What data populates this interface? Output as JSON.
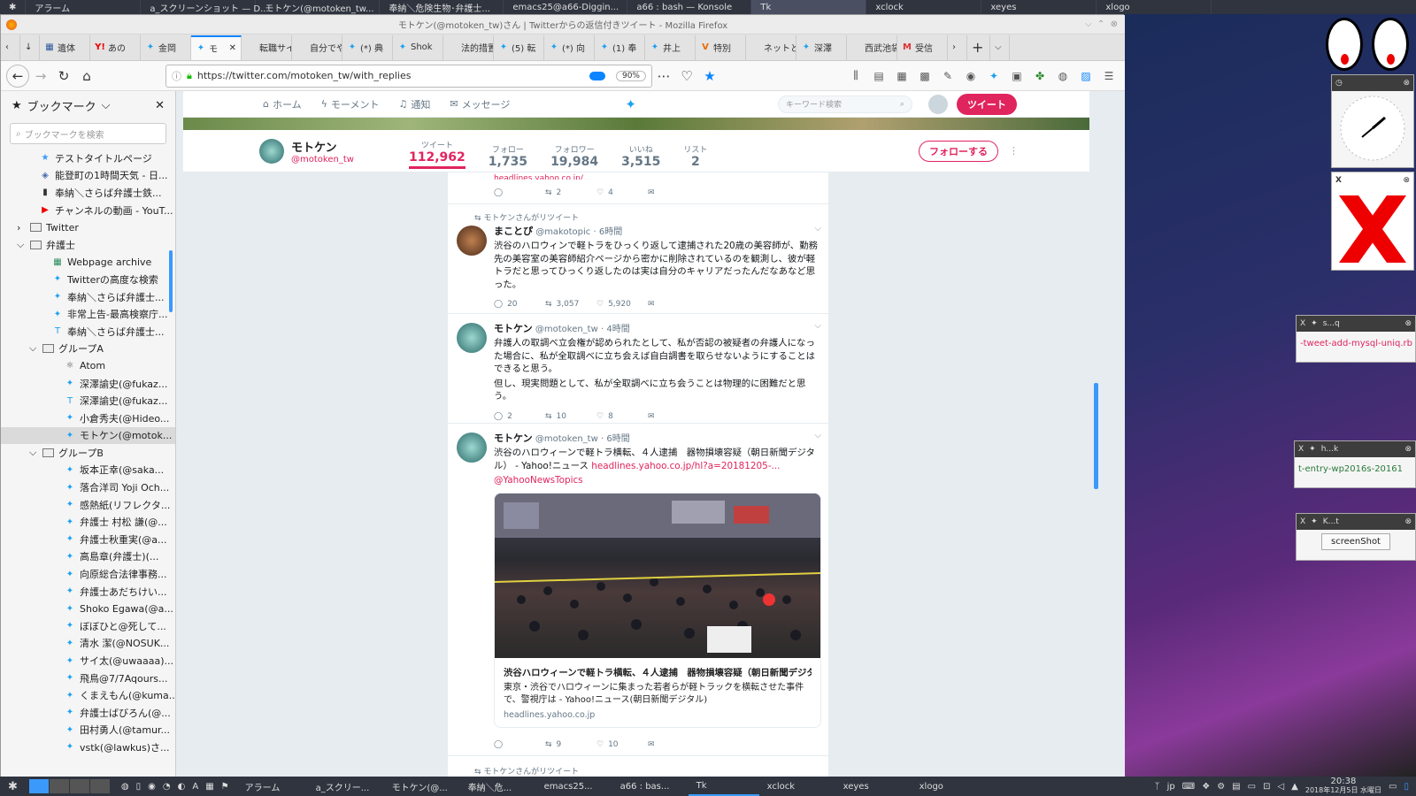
{
  "topbar": {
    "items": [
      "アラーム",
      "a_スクリーンショット — D...",
      "モトケン(@motoken_tw...",
      "奉納＼危険生物･弁護士...",
      "emacs25@a66-Diggin...",
      "a66 : bash — Konsole",
      "Tk",
      "xclock",
      "xeyes",
      "xlogo"
    ]
  },
  "window": {
    "title": "モトケン(@motoken_tw)さん | Twitterからの返信付きツイート - Mozilla Firefox"
  },
  "tabs": [
    {
      "label": "遺体",
      "icon": "jp"
    },
    {
      "label": "あの",
      "icon": "y"
    },
    {
      "label": "金岡",
      "icon": "tw"
    },
    {
      "label": "モ",
      "icon": "tw",
      "selected": true
    },
    {
      "label": "転職サイ",
      "icon": ""
    },
    {
      "label": "自分でや",
      "icon": ""
    },
    {
      "label": "(*) 典",
      "icon": "tw"
    },
    {
      "label": "Shok",
      "icon": "tw"
    },
    {
      "label": "法的措置",
      "icon": ""
    },
    {
      "label": "(5) 転",
      "icon": "tw"
    },
    {
      "label": "(*) 向",
      "icon": "tw"
    },
    {
      "label": "(1) 奉",
      "icon": "tw"
    },
    {
      "label": "井上",
      "icon": "tw"
    },
    {
      "label": "特別",
      "icon": "v"
    },
    {
      "label": "ネットと著",
      "icon": ""
    },
    {
      "label": "深澤",
      "icon": "tw"
    },
    {
      "label": "西武池袋",
      "icon": ""
    },
    {
      "label": "受信",
      "icon": "m"
    }
  ],
  "url": {
    "value": "https://twitter.com/motoken_tw/with_replies",
    "zoom": "90%"
  },
  "sidebar": {
    "title": "ブックマーク",
    "search_placeholder": "ブックマークを検索",
    "items": [
      {
        "label": "テストタイトルページ",
        "indent": 44,
        "icon": "star",
        "type": "bm"
      },
      {
        "label": "能登町の1時間天気 - 日...",
        "indent": 44,
        "icon": "cube",
        "type": "bm"
      },
      {
        "label": "奉納＼さらば弁護士鉄...",
        "indent": 44,
        "icon": "bar",
        "type": "bm"
      },
      {
        "label": "チャンネルの動画 - YouT...",
        "indent": 44,
        "icon": "yt",
        "type": "bm"
      },
      {
        "label": "Twitter",
        "indent": 32,
        "icon": "folder",
        "type": "folder",
        "collapsed": true
      },
      {
        "label": "弁護士",
        "indent": 32,
        "icon": "folder",
        "type": "folder"
      },
      {
        "label": "Webpage archive",
        "indent": 58,
        "icon": "arc",
        "type": "bm"
      },
      {
        "label": "Twitterの高度な検索",
        "indent": 58,
        "icon": "tw",
        "type": "bm"
      },
      {
        "label": "奉納＼さらば弁護士...",
        "indent": 58,
        "icon": "tw",
        "type": "bm"
      },
      {
        "label": "非常上告-最高検察庁...",
        "indent": 58,
        "icon": "tw",
        "type": "bm"
      },
      {
        "label": "奉納＼さらば弁護士...",
        "indent": 58,
        "icon": "t",
        "type": "bm"
      },
      {
        "label": "グループA",
        "indent": 46,
        "icon": "folder",
        "type": "folder"
      },
      {
        "label": "Atom",
        "indent": 72,
        "icon": "atom",
        "type": "bm"
      },
      {
        "label": "深澤諭史(@fukaz...",
        "indent": 72,
        "icon": "tw",
        "type": "bm"
      },
      {
        "label": "深澤諭史(@fukaz...",
        "indent": 72,
        "icon": "t",
        "type": "bm"
      },
      {
        "label": "小倉秀夫(@Hideo...",
        "indent": 72,
        "icon": "tw",
        "type": "bm"
      },
      {
        "label": "モトケン(@motok...",
        "indent": 72,
        "icon": "tw",
        "type": "bm",
        "selected": true
      },
      {
        "label": "グループB",
        "indent": 46,
        "icon": "folder",
        "type": "folder"
      },
      {
        "label": "坂本正幸(@saka...",
        "indent": 72,
        "icon": "tw",
        "type": "bm"
      },
      {
        "label": "落合洋司 Yoji Och...",
        "indent": 72,
        "icon": "tw",
        "type": "bm"
      },
      {
        "label": "感熱紙(リフレクタ...",
        "indent": 72,
        "icon": "tw",
        "type": "bm"
      },
      {
        "label": "弁護士 村松 謙(@...",
        "indent": 72,
        "icon": "tw",
        "type": "bm"
      },
      {
        "label": "弁護士秋重実(@a...",
        "indent": 72,
        "icon": "tw",
        "type": "bm"
      },
      {
        "label": "高島章(弁護士)(...",
        "indent": 72,
        "icon": "tw",
        "type": "bm"
      },
      {
        "label": "向原総合法律事務...",
        "indent": 72,
        "icon": "tw",
        "type": "bm"
      },
      {
        "label": "弁護士あだちけい...",
        "indent": 72,
        "icon": "tw",
        "type": "bm"
      },
      {
        "label": "Shoko Egawa(@a...",
        "indent": 72,
        "icon": "tw",
        "type": "bm"
      },
      {
        "label": "ぼぼひと@死して...",
        "indent": 72,
        "icon": "tw",
        "type": "bm"
      },
      {
        "label": "清水 潔(@NOSUK...",
        "indent": 72,
        "icon": "tw",
        "type": "bm"
      },
      {
        "label": "サイ太(@uwaaaa)...",
        "indent": 72,
        "icon": "tw",
        "type": "bm"
      },
      {
        "label": "飛鳥@7/7Aqours...",
        "indent": 72,
        "icon": "tw",
        "type": "bm"
      },
      {
        "label": "くまえもん(@kuma...",
        "indent": 72,
        "icon": "tw",
        "type": "bm"
      },
      {
        "label": "弁護士ばびろん(@...",
        "indent": 72,
        "icon": "tw",
        "type": "bm"
      },
      {
        "label": "田村勇人(@tamur...",
        "indent": 72,
        "icon": "tw",
        "type": "bm"
      },
      {
        "label": "vstk(@lawkus)さ...",
        "indent": 72,
        "icon": "tw",
        "type": "bm"
      }
    ]
  },
  "twitter": {
    "nav": {
      "home": "ホーム",
      "moments": "モーメント",
      "notifications": "通知",
      "messages": "メッセージ",
      "search_placeholder": "キーワード検索",
      "tweet_button": "ツイート"
    },
    "profile": {
      "name": "モトケン",
      "handle": "@motoken_tw",
      "stats": [
        {
          "label": "ツイート",
          "value": "112,962",
          "active": true
        },
        {
          "label": "フォロー",
          "value": "1,735"
        },
        {
          "label": "フォロワー",
          "value": "19,984"
        },
        {
          "label": "いいね",
          "value": "3,515"
        },
        {
          "label": "リスト",
          "value": "2"
        }
      ],
      "follow_button": "フォローする"
    },
    "tweets": [
      {
        "partial": true,
        "replies": "",
        "retweets": "2",
        "likes": "4"
      },
      {
        "retweet_note": "モトケンさんがリツイート",
        "name": "まことぴ",
        "handle": "@makotopic",
        "time": "6時間",
        "text": "渋谷のハロウィンで軽トラをひっくり返して逮捕された20歳の美容師が、勤務先の美容室の美容師紹介ページから密かに削除されているのを観測し、彼が軽トラだと思ってひっくり返したのは実は自分のキャリアだったんだなあなど思った。",
        "replies": "20",
        "retweets": "3,057",
        "likes": "5,920"
      },
      {
        "name": "モトケン",
        "handle": "@motoken_tw",
        "time": "4時間",
        "text": "弁護人の取調べ立会権が認められたとして、私が否認の被疑者の弁護人になった場合に、私が全取調べに立ち会えば自白調書を取らせないようにすることはできると思う。",
        "text2": "但し、現実問題として、私が全取調べに立ち会うことは物理的に困難だと思う。",
        "replies": "2",
        "retweets": "10",
        "likes": "8"
      },
      {
        "name": "モトケン",
        "handle": "@motoken_tw",
        "time": "6時間",
        "text": "渋谷のハロウィーンで軽トラ横転、４人逮捕　器物損壊容疑（朝日新聞デジタル） - Yahoo!ニュース",
        "link": "headlines.yahoo.co.jp/hl?a=20181205-...",
        "mention": "@YahooNewsTopics",
        "card_title": "渋谷ハロウィーンで軽トラ横転、４人逮捕　器物損壊容疑（朝日新聞デジタ...",
        "card_desc": "東京・渋谷でハロウィーンに集まった若者らが軽トラックを横転させた事件で、警視庁は - Yahoo!ニュース(朝日新聞デジタル)",
        "card_domain": "headlines.yahoo.co.jp",
        "replies": "",
        "retweets": "9",
        "likes": "10"
      }
    ],
    "next_retweet_note": "モトケンさんがリツイート"
  },
  "widgets": {
    "w1_title": "s...q",
    "w1_text": "-tweet-add-mysql-uniq.rb",
    "w2_title": "h...k",
    "w2_text": "t-entry-wp2016s-20161",
    "w3_title": "K...t",
    "w3_button": "screenShot"
  },
  "bottombar": {
    "items": [
      "アラーム",
      "a_スクリー...",
      "モトケン(@...",
      "奉納＼危...",
      "emacs25...",
      "a66 : bas...",
      "Tk",
      "xclock",
      "xeyes",
      "xlogo"
    ],
    "clock_time": "20:38",
    "clock_date": "2018年12月5日 水曜日",
    "lang": "jp"
  },
  "colors": {
    "accent": "#e0245e",
    "twitter_blue": "#1da1f2",
    "ff_blue": "#0a84ff"
  }
}
